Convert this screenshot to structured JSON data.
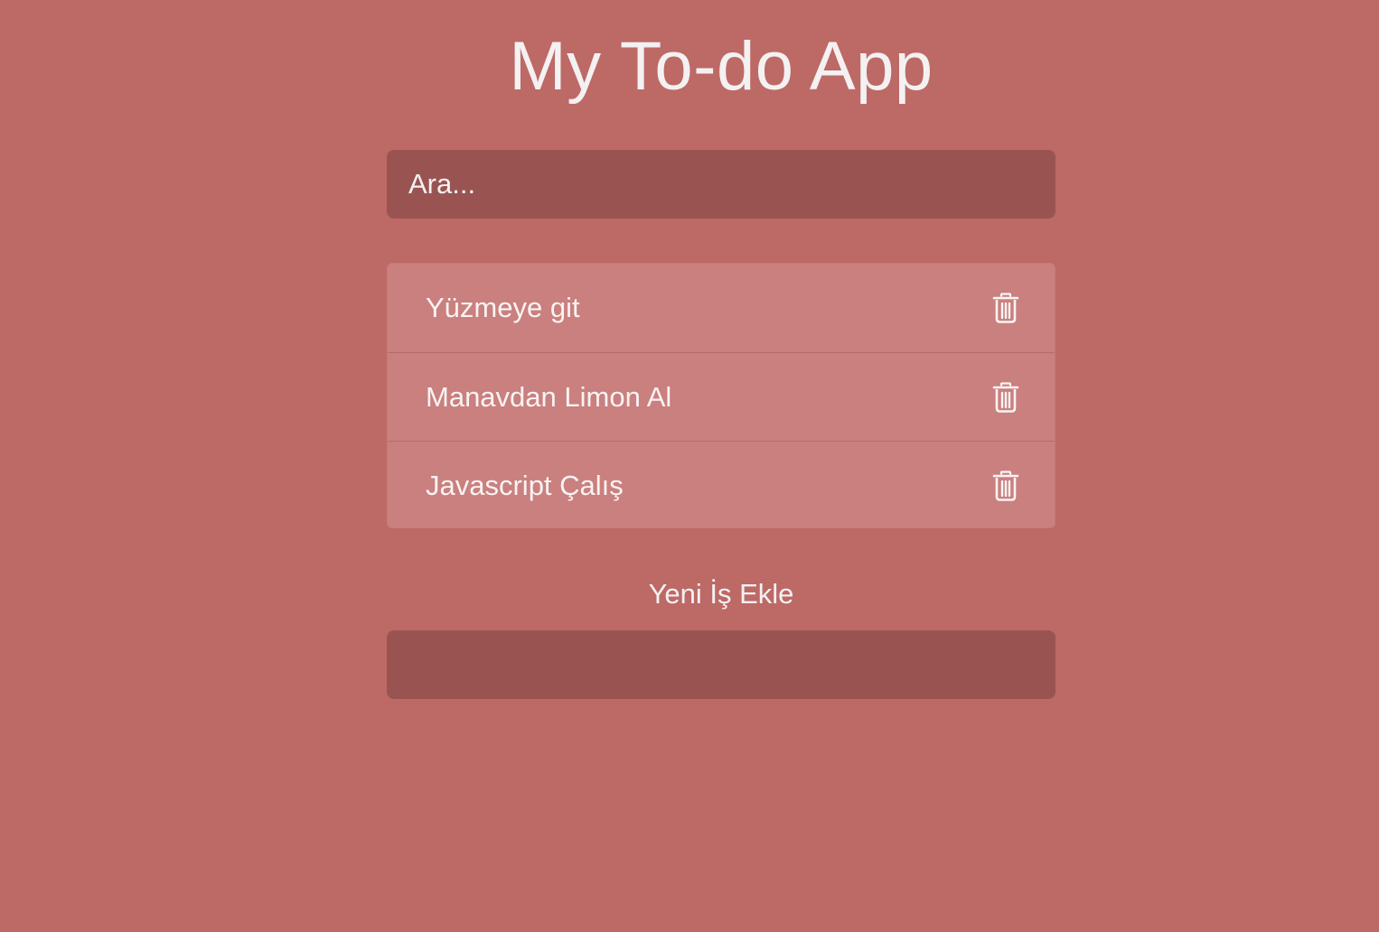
{
  "app": {
    "title": "My To-do App"
  },
  "search": {
    "placeholder": "Ara..."
  },
  "todos": [
    {
      "label": "Yüzmeye git",
      "delete_icon": "trash-icon"
    },
    {
      "label": "Manavdan Limon Al",
      "delete_icon": "trash-icon"
    },
    {
      "label": "Javascript Çalış",
      "delete_icon": "trash-icon"
    }
  ],
  "add": {
    "label": "Yeni İş Ekle",
    "value": ""
  },
  "colors": {
    "background": "#bd6966",
    "input_background": "#995452",
    "list_background": "#ca807e",
    "text": "#f4f1f2"
  }
}
